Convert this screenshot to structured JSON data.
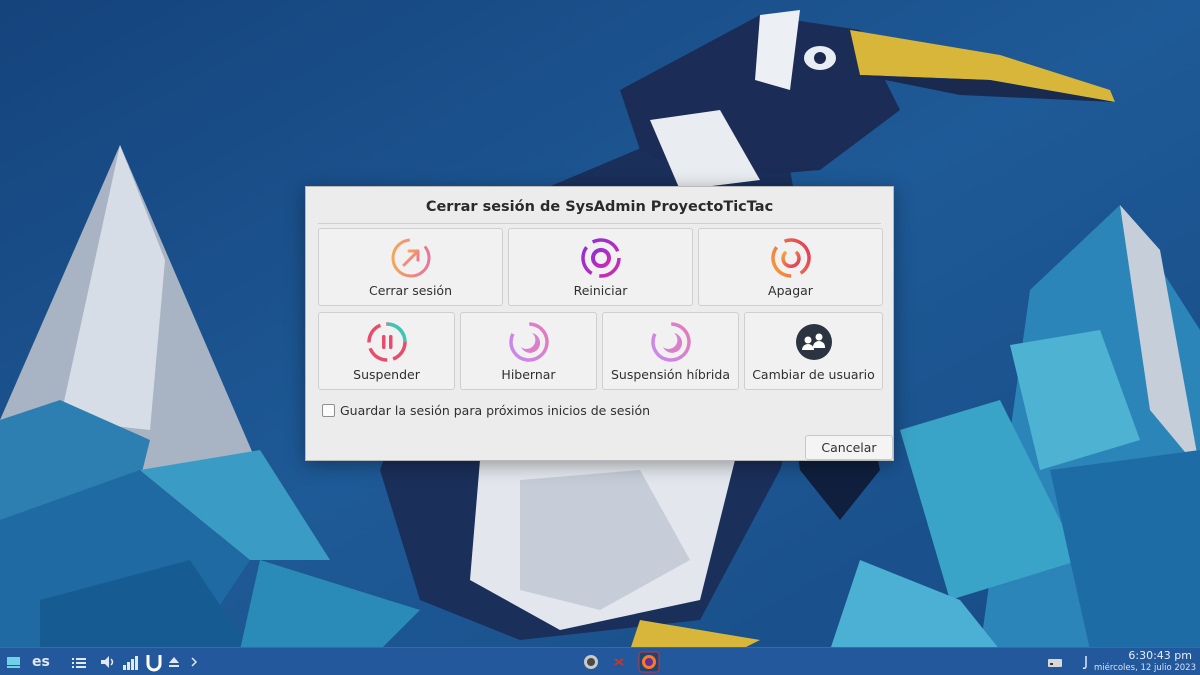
{
  "dialog": {
    "title": "Cerrar sesión de SysAdmin ProyectoTicTac",
    "actions_row1": [
      {
        "label": "Cerrar sesión",
        "icon": "logout-icon"
      },
      {
        "label": "Reiniciar",
        "icon": "restart-icon"
      },
      {
        "label": "Apagar",
        "icon": "power-icon"
      }
    ],
    "actions_row2": [
      {
        "label": "Suspender",
        "icon": "suspend-icon"
      },
      {
        "label": "Hibernar",
        "icon": "moon-icon"
      },
      {
        "label": "Suspensión híbrida",
        "icon": "moon-icon"
      },
      {
        "label": "Cambiar de usuario",
        "icon": "switch-user-icon"
      }
    ],
    "save_session_label": "Guardar la sesión para próximos inicios de sesión",
    "save_session_checked": false,
    "cancel_label": "Cancelar"
  },
  "taskbar": {
    "keyboard_layout": "es",
    "clock_time": "6:30:43 pm",
    "clock_date": "miércoles, 12 julio 2023"
  },
  "colors": {
    "wallpaper_dark": "#163e73",
    "wallpaper_ice": "#3ba7c9",
    "taskbar": "#23599c",
    "dialog_bg": "#ececec"
  }
}
